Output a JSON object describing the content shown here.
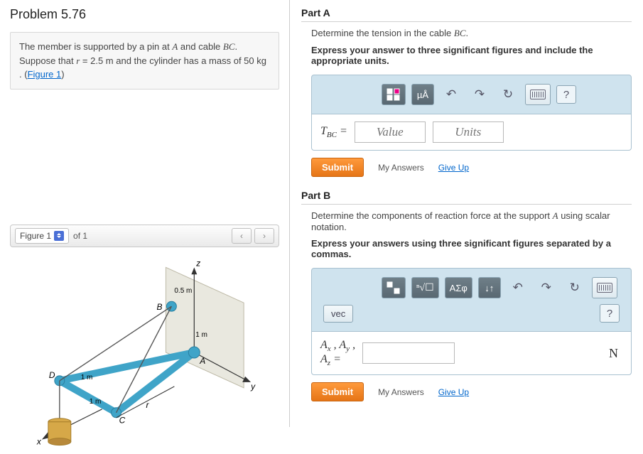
{
  "problem": {
    "title": "Problem 5.76",
    "statement_pre": "The member is supported by a pin at ",
    "statement_A": "A",
    "statement_mid1": " and cable ",
    "statement_BC": "BC",
    "statement_mid2": ". Suppose that ",
    "statement_rvar": "r",
    "statement_mid3": " = 2.5  m and the cylinder has a mass of 50  kg . (",
    "figure_link": "Figure 1",
    "statement_end": ")"
  },
  "figure_bar": {
    "label": "Figure 1",
    "of_label": "of 1"
  },
  "figure": {
    "z": "z",
    "y": "y",
    "x": "x",
    "r": "r",
    "A": "A",
    "B": "B",
    "C": "C",
    "D": "D",
    "d05": "0.5 m",
    "d1a": "1 m",
    "d1b": "1 m",
    "d1c": "1 m"
  },
  "partA": {
    "header": "Part A",
    "prompt_pre": "Determine the tension in the cable ",
    "prompt_BC": "BC",
    "prompt_post": ".",
    "instr": "Express your answer to three significant figures and include the appropriate units.",
    "toolbar": {
      "units_btn": "µÅ",
      "help": "?"
    },
    "eq_label_T": "T",
    "eq_label_sub": "BC",
    "eq_label_eq": " = ",
    "value_ph": "Value",
    "units_ph": "Units",
    "submit": "Submit",
    "my_answers": "My Answers",
    "give_up": "Give Up"
  },
  "partB": {
    "header": "Part B",
    "prompt_pre": "Determine the components of reaction force at the support ",
    "prompt_A": "A",
    "prompt_post": " using scalar notation.",
    "instr": "Express your answers using three significant figures separated by a commas.",
    "toolbar": {
      "greek_btn": "ΑΣφ",
      "sort_btn": "↓↑",
      "help": "?"
    },
    "vec_btn": "vec",
    "eq_Ax": "A",
    "eq_Ax_sub": "x",
    "eq_Ay": "A",
    "eq_Ay_sub": "y",
    "eq_Az": "A",
    "eq_Az_sub": "z",
    "eq_eq": " = ",
    "unit": "N",
    "submit": "Submit",
    "my_answers": "My Answers",
    "give_up": "Give Up"
  }
}
